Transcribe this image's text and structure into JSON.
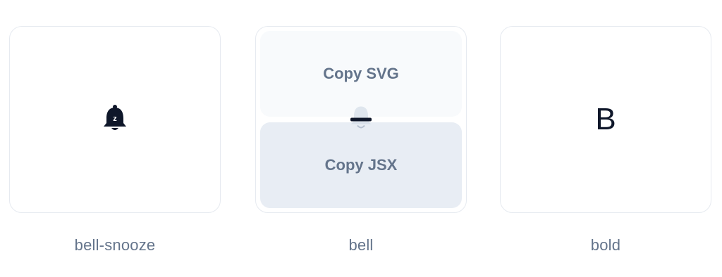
{
  "icons": [
    {
      "label": "bell-snooze",
      "icon": "bell-snooze-icon"
    },
    {
      "label": "bell",
      "icon": "bell-icon",
      "actions": {
        "copy_svg": "Copy SVG",
        "copy_jsx": "Copy JSX"
      }
    },
    {
      "label": "bold",
      "icon": "bold-icon",
      "glyph": "B"
    }
  ],
  "colors": {
    "border": "#e6eaf0",
    "label": "#64748b",
    "icon": "#0f172a",
    "copy_svg_bg": "#f8fafc",
    "copy_jsx_bg": "#e8edf4"
  }
}
